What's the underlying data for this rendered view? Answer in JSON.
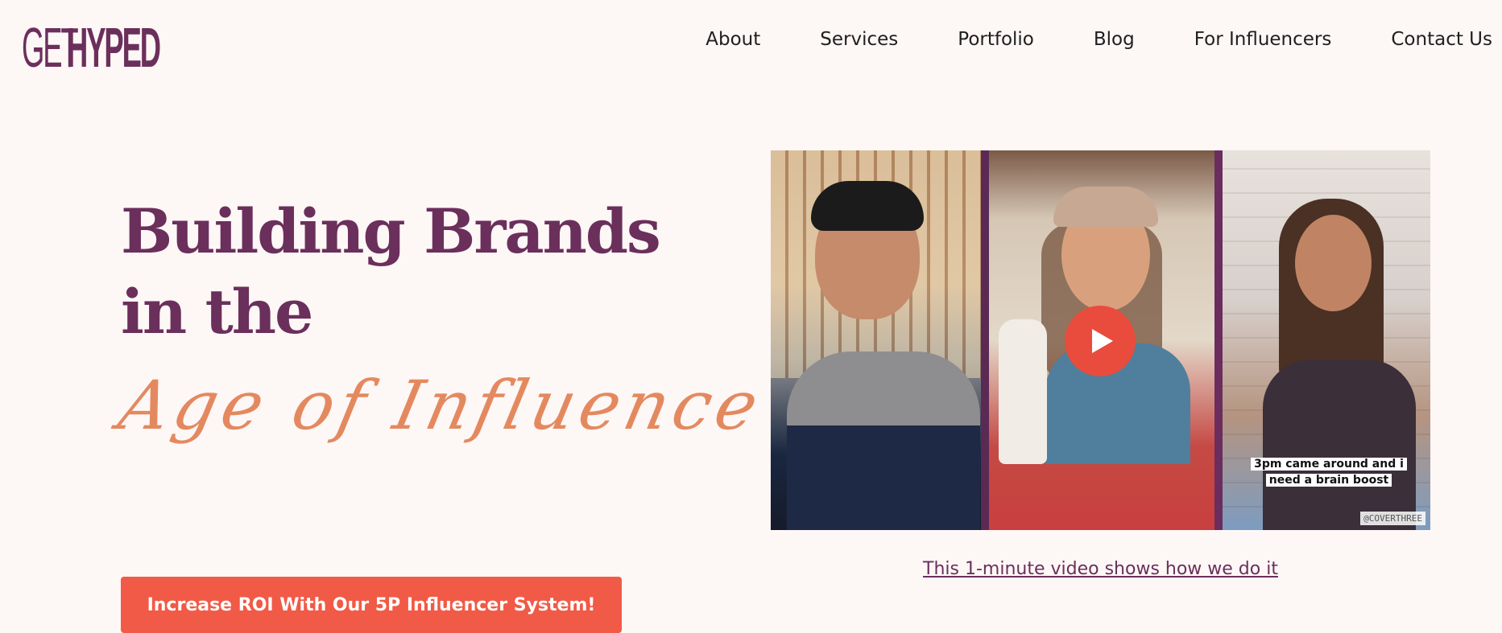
{
  "brand": {
    "logo_light": "GET",
    "logo_bold": "HYPED"
  },
  "nav": {
    "items": [
      {
        "label": "About"
      },
      {
        "label": "Services"
      },
      {
        "label": "Portfolio"
      },
      {
        "label": "Blog"
      },
      {
        "label": "For Influencers"
      },
      {
        "label": "Contact Us"
      }
    ]
  },
  "hero": {
    "line1": "Building Brands",
    "line2": "in the",
    "script": "Age of Influence",
    "cta_label": "Increase ROI With Our 5P Influencer System!"
  },
  "video": {
    "caption_line1": "3pm came around and i",
    "caption_line2": "need a brain boost",
    "handle": "@COVERTHREE",
    "link_text": "This 1-minute video shows how we do it"
  },
  "colors": {
    "brand_purple": "#6b2f5c",
    "accent_orange": "#e4895f",
    "cta_red": "#f15a46",
    "background": "#fdf7f6"
  }
}
